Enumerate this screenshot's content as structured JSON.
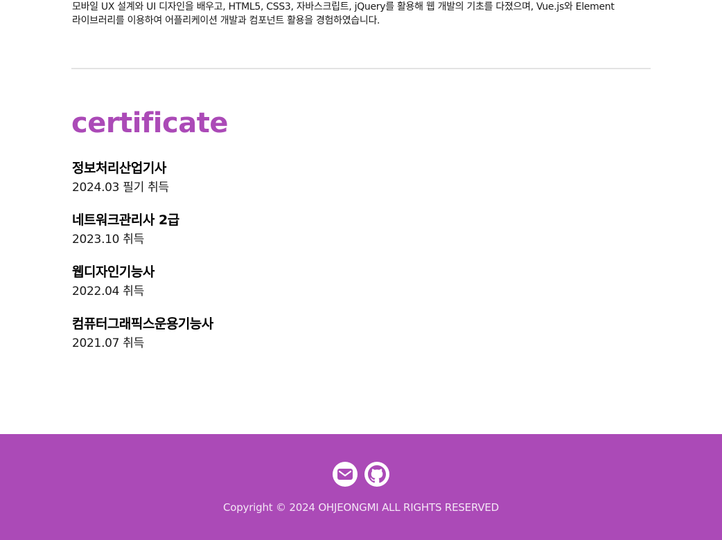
{
  "intro": {
    "line1": "모바일 UX 설계와 UI 디자인을 배우고, HTML5, CSS3, 자바스크립트, jQuery를 활용해 웹 개발의 기초를 다졌으며, Vue.js와 Element",
    "line2": "라이브러리를 이용하여 어플리케이션 개발과 컴포넌트 활용을 경험하였습니다."
  },
  "certificate": {
    "title": "certificate",
    "items": [
      {
        "name": "정보처리산업기사",
        "date": "2024.03 필기 취득"
      },
      {
        "name": "네트워크관리사 2급",
        "date": "2023.10 취득"
      },
      {
        "name": "웹디자인기능사",
        "date": "2022.04 취득"
      },
      {
        "name": "컴퓨터그래픽스운용기능사",
        "date": "2021.07 취득"
      }
    ]
  },
  "footer": {
    "icons": [
      "mail-icon",
      "github-icon"
    ],
    "copyright": "Copyright © 2024 OHJEONGMI ALL RIGHTS RESERVED"
  },
  "colors": {
    "accent": "#ab4ab7",
    "footer_bg": "#ab4ab7",
    "divider": "#e3e3e3"
  }
}
